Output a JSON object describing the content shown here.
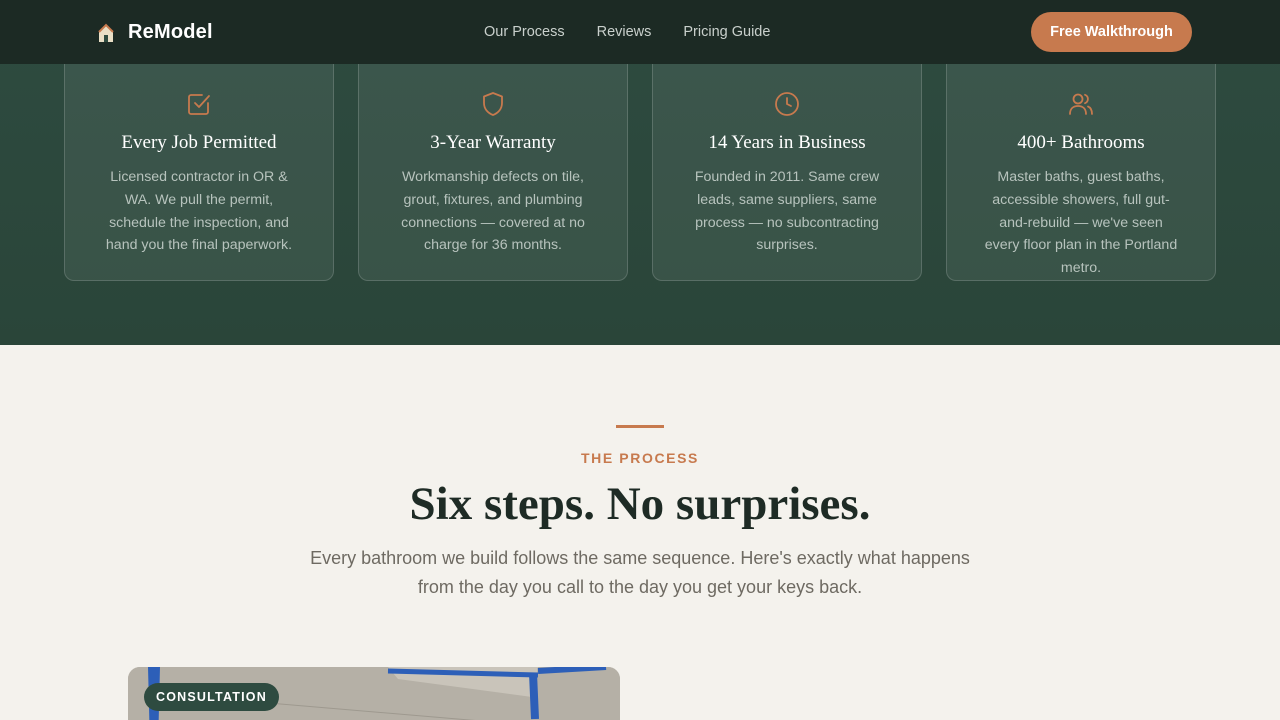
{
  "nav": {
    "brand": "ReModel",
    "links": [
      "Our Process",
      "Reviews",
      "Pricing Guide"
    ],
    "cta": "Free Walkthrough"
  },
  "features": [
    {
      "icon": "checkbox-icon",
      "title": "Every Job Permitted",
      "text": "Licensed contractor in OR & WA. We pull the permit, schedule the inspection, and hand you the final paperwork."
    },
    {
      "icon": "shield-icon",
      "title": "3-Year Warranty",
      "text": "Workmanship defects on tile, grout, fixtures, and plumbing connections — covered at no charge for 36 months."
    },
    {
      "icon": "clock-icon",
      "title": "14 Years in Business",
      "text": "Founded in 2011. Same crew leads, same suppliers, same process — no subcontracting surprises."
    },
    {
      "icon": "users-icon",
      "title": "400+ Bathrooms",
      "text": "Master baths, guest baths, accessible showers, full gut-and-rebuild — we've seen every floor plan in the Portland metro."
    }
  ],
  "process": {
    "eyebrow": "THE PROCESS",
    "headline": "Six steps. No surprises.",
    "lede": "Every bathroom we build follows the same sequence. Here's exactly what happens from the day you call to the day you get your keys back.",
    "first_step_badge": "CONSULTATION"
  },
  "colors": {
    "accent": "#c77a4e",
    "forest": "#2e4b40",
    "nav": "#1c2a24",
    "cream": "#f4f2ed"
  }
}
